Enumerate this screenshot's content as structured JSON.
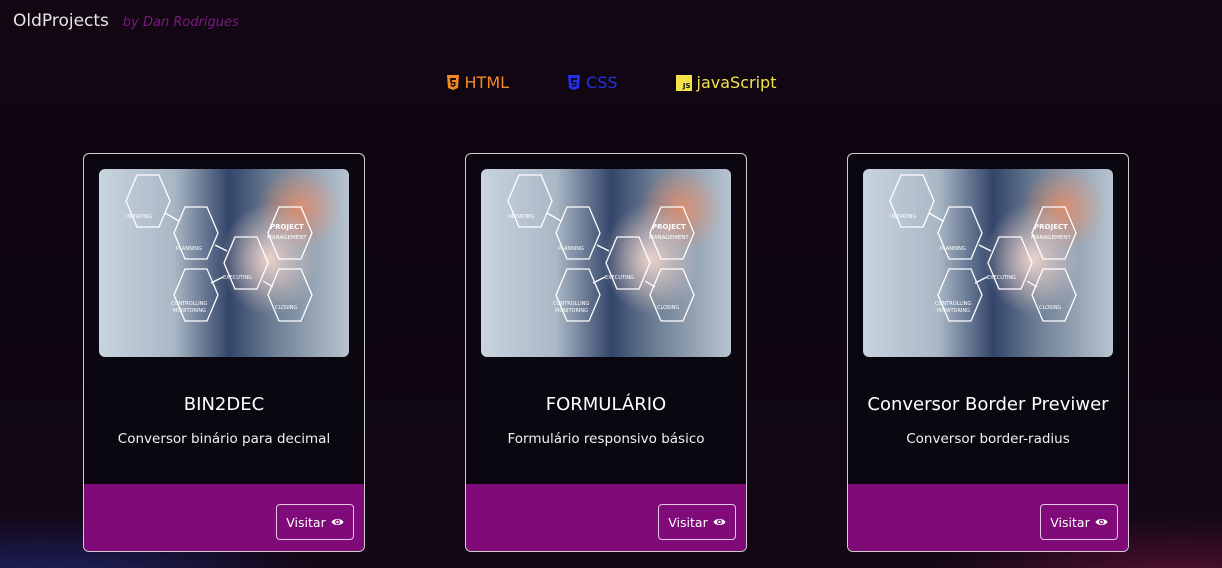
{
  "header": {
    "brand": "OldProjects",
    "byline": "by Dan Rodrigues"
  },
  "techs": [
    {
      "label": "HTML",
      "icon": "html5-icon",
      "color": "#f08a24"
    },
    {
      "label": "CSS",
      "icon": "css3-icon",
      "color": "#2430e8"
    },
    {
      "label": "javaScript",
      "icon": "js-icon",
      "color": "#f2e34a",
      "badge": "JS"
    }
  ],
  "cards": [
    {
      "title": "BIN2DEC",
      "description": "Conversor binário para decimal",
      "button": "Visitar"
    },
    {
      "title": "FORMULÁRIO",
      "description": "Formulário responsivo básico",
      "button": "Visitar"
    },
    {
      "title": "Conversor Border Previwer",
      "description": "Conversor border-radius",
      "button": "Visitar"
    }
  ],
  "thumbnail": {
    "labels": [
      "INITIATING",
      "PLANNING",
      "EXECUTING",
      "PROJECT",
      "MANAGEMENT",
      "CONTROLLING",
      "MONITORING",
      "CLOSING"
    ]
  },
  "colors": {
    "accent": "#800a78",
    "byline": "#7a1a80"
  }
}
